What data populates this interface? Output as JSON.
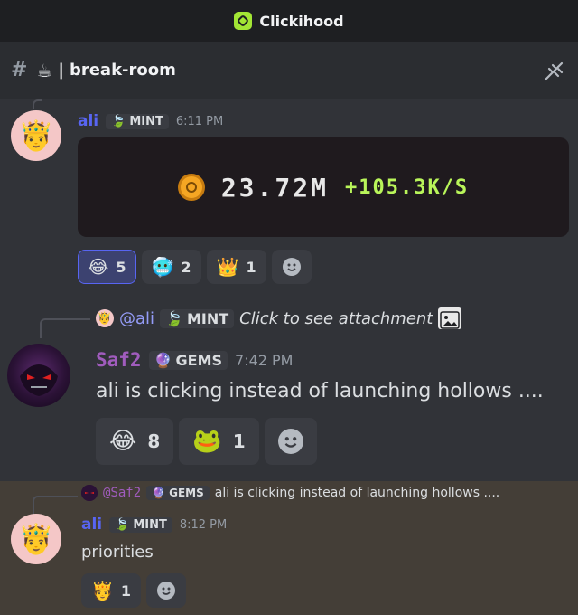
{
  "app": {
    "title": "Clickihood"
  },
  "channel": {
    "hash": "#",
    "emoji": "☕",
    "separator": "|",
    "name": "break-room"
  },
  "messages": [
    {
      "author": "ali",
      "tag": "MINT",
      "time": "6:11 PM",
      "embed": {
        "amount": "23.72M",
        "rate": "+105.3K/S"
      },
      "reactions": [
        {
          "emoji": "😂",
          "count": "5",
          "active": true
        },
        {
          "emoji": "🥶",
          "count": "2",
          "active": false
        },
        {
          "emoji": "👑",
          "count": "1",
          "active": false
        }
      ]
    },
    {
      "reply": {
        "author": "@ali",
        "tag": "MINT",
        "text": "Click to see attachment"
      },
      "author": "Saf2",
      "tag": "GEMS",
      "time": "7:42 PM",
      "text": "ali is clicking instead of launching hollows ....",
      "reactions": [
        {
          "emoji": "😂",
          "count": "8"
        },
        {
          "emoji": "🐸",
          "count": "1"
        }
      ]
    },
    {
      "reply": {
        "author": "@Saf2",
        "tag": "GEMS",
        "text": "ali is clicking instead of launching hollows ...."
      },
      "author": "ali",
      "tag": "MINT",
      "time": "8:12 PM",
      "text": "priorities",
      "reactions": [
        {
          "emoji": "🫅",
          "count": "1"
        }
      ]
    }
  ]
}
